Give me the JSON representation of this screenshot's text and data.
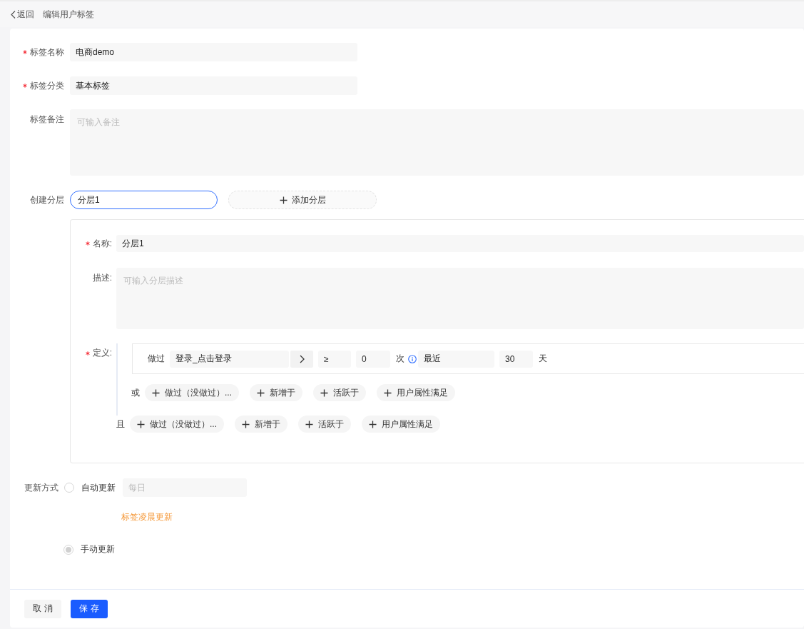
{
  "header": {
    "back": "返回",
    "title": "编辑用户标签"
  },
  "fields": [
    {
      "label": "标签名称",
      "required": true,
      "value": "电商demo"
    },
    {
      "label": "标签分类",
      "required": true,
      "value": "基本标签"
    }
  ],
  "remark": {
    "label": "标签备注",
    "required": false,
    "placeholder": "可输入备注"
  },
  "layers": {
    "label": "创建分层",
    "tabs": [
      {
        "value": "分层1",
        "selected": true
      }
    ],
    "add_button": "添加分层"
  },
  "layer": {
    "name_label": "名称:",
    "name_required": true,
    "name_value": "分层1",
    "desc_label": "描述:",
    "desc_required": false,
    "desc_placeholder": "可输入分层描述",
    "definition_label": "定义:",
    "definition_required": true,
    "condition": {
      "prefix": "做过",
      "event": "登录_点击登录",
      "operator": "≥",
      "count": "0",
      "count_unit": "次",
      "range": "最近",
      "days": "30",
      "days_unit": "天"
    },
    "or_label": "或",
    "or_chips": [
      "做过（没做过）...",
      "新增于",
      "活跃于",
      "用户属性满足"
    ],
    "and_label": "且",
    "and_chips": [
      "做过（没做过）...",
      "新增于",
      "活跃于",
      "用户属性满足"
    ]
  },
  "update": {
    "label": "更新方式",
    "options": [
      {
        "kind": "auto",
        "label": "自动更新",
        "selected": false,
        "frequency_placeholder": "每日",
        "note": "标签凌晨更新"
      },
      {
        "kind": "manual",
        "label": "手动更新",
        "selected": true
      }
    ]
  },
  "footer": {
    "cancel": "取消",
    "save": "保存"
  }
}
